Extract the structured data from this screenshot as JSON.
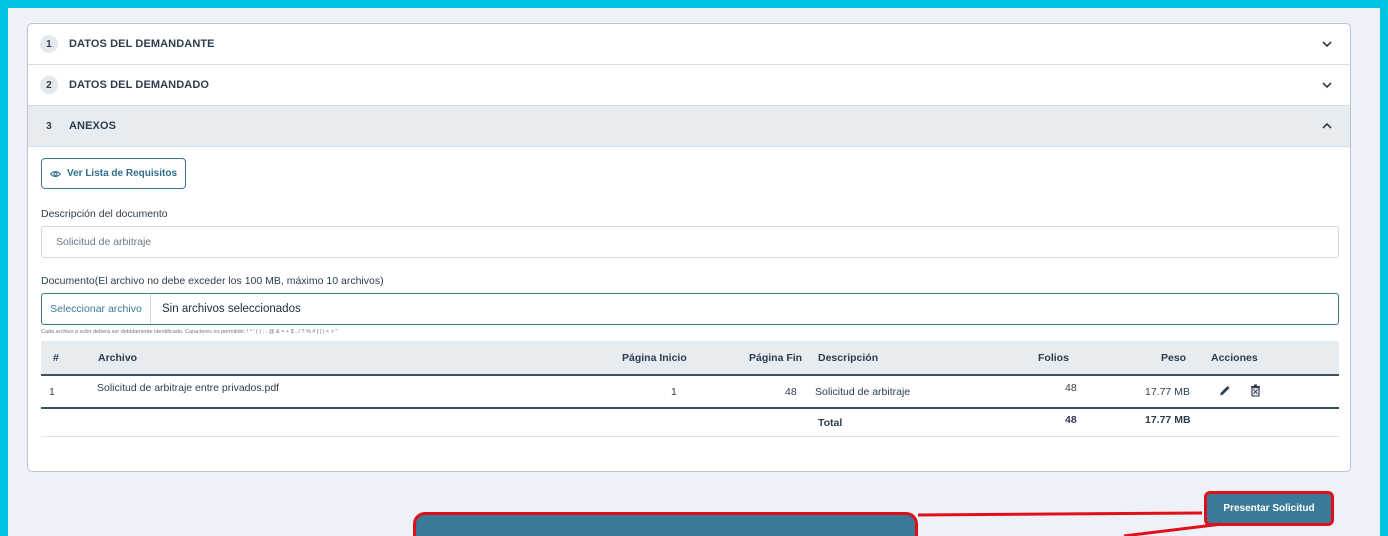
{
  "accordion": {
    "sections": [
      {
        "number": "1",
        "title": "DATOS DEL DEMANDANTE"
      },
      {
        "number": "2",
        "title": "DATOS DEL DEMANDADO"
      },
      {
        "number": "3",
        "title": "ANEXOS"
      }
    ]
  },
  "anexos": {
    "requirements_button": "Ver Lista de Requisitos",
    "description_label": "Descripción del documento",
    "description_value": "Solicitud de arbitraje",
    "document_label": "Documento(El archivo no debe exceder los 100 MB, máximo 10 archivos)",
    "file_button": "Seleccionar archivo",
    "file_value": "Sin archivos seleccionados",
    "hint": "Cada archivo a subir deberá ser debidamente identificado. Caracteres no permitido: ! * ' ( ) ; : @ & = + $ , / ? % # [ ] | < > \""
  },
  "table": {
    "headers": {
      "num": "#",
      "file": "Archivo",
      "start_page": "Página Inicio",
      "end_page": "Página Fin",
      "description": "Descripción",
      "folios": "Folios",
      "size": "Peso",
      "actions": "Acciones"
    },
    "rows": [
      {
        "num": "1",
        "file": "Solicitud de arbitraje entre privados.pdf",
        "start_page": "1",
        "end_page": "48",
        "description": "Solicitud de arbitraje",
        "folios": "48",
        "size": "17.77 MB"
      }
    ],
    "total": {
      "label": "Total",
      "folios": "48",
      "size": "17.77 MB"
    }
  },
  "footer": {
    "submit_button": "Presentar Solicitud"
  },
  "colors": {
    "frame": "#00c3e3",
    "primary": "#3c7b98",
    "highlight": "#e0101a"
  }
}
